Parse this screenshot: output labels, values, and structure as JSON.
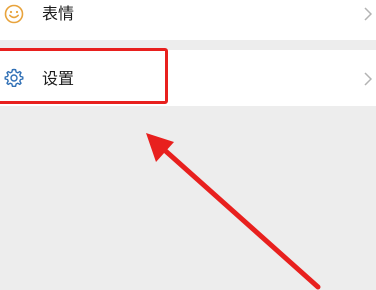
{
  "menu": {
    "items": [
      {
        "label": "表情",
        "icon": "smiley-icon"
      },
      {
        "label": "设置",
        "icon": "gear-icon"
      }
    ]
  },
  "annotation": {
    "highlight_color": "#e8201e",
    "target": "设置"
  },
  "colors": {
    "background": "#ededed",
    "row": "#ffffff",
    "icon_emoji": "#e8a33c",
    "icon_settings": "#2f6fb5",
    "chevron": "#b3b3b3"
  }
}
